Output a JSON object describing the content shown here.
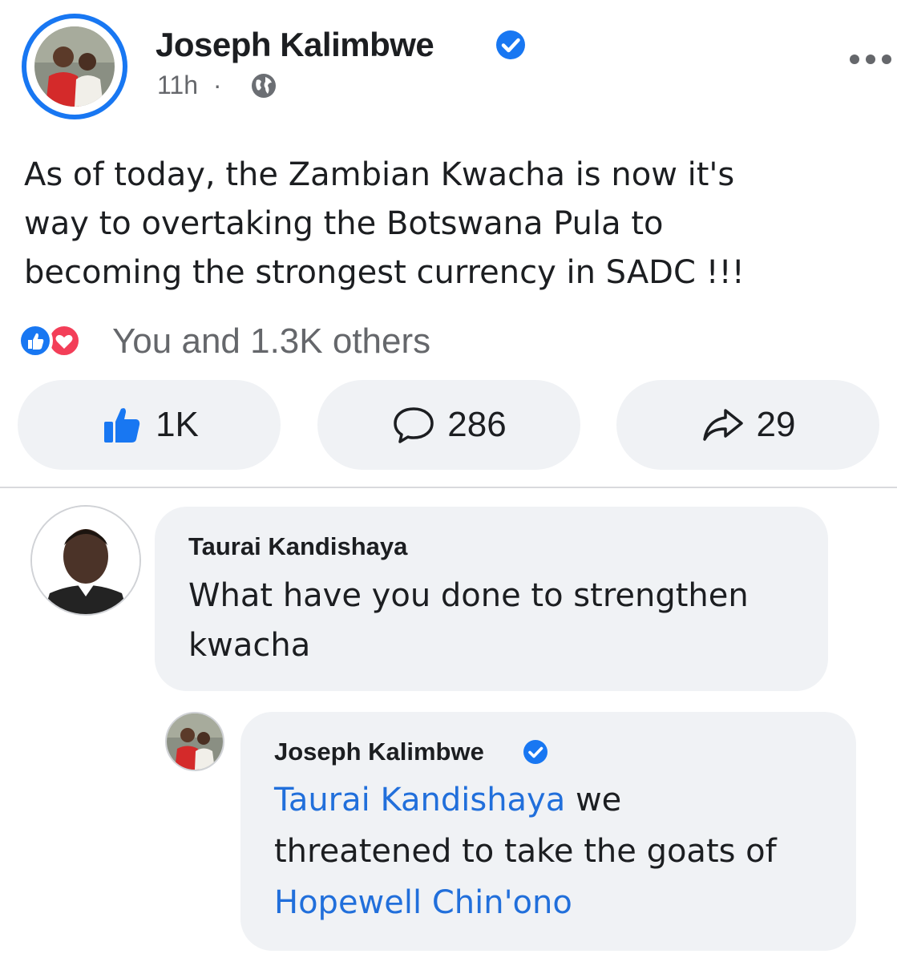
{
  "post": {
    "author": "Joseph Kalimbwe",
    "time": "11h",
    "separator": "·",
    "privacy_icon": "globe-icon",
    "body": "As of today, the Zambian Kwacha is now it's way to overtaking the Botswana Pula to becoming the strongest currency in SADC !!!",
    "body_lines": [
      "As of today, the Zambian Kwacha is now it's",
      "way to overtaking the Botswana Pula to",
      "becoming the strongest currency in SADC !!!"
    ],
    "reactions_text": "You and 1.3K others",
    "reaction_icons": [
      "like-icon",
      "love-icon"
    ]
  },
  "actions": {
    "like_count": "1K",
    "comment_count": "286",
    "share_count": "29"
  },
  "comments": [
    {
      "author": "Taurai Kandishaya",
      "text_lines": [
        "What have you done to strengthen",
        "kwacha"
      ]
    }
  ],
  "reply": {
    "author": "Joseph Kalimbwe",
    "mention_1": "Taurai Kandishaya",
    "text_1": " we",
    "text_2": "threatened to take the goats of",
    "mention_2": "Hopewell Chin'ono"
  },
  "colors": {
    "accent": "#1877f2",
    "mention": "#216fdb",
    "muted": "#65676b",
    "bubble": "#f0f2f5",
    "love": "#f33e58"
  }
}
